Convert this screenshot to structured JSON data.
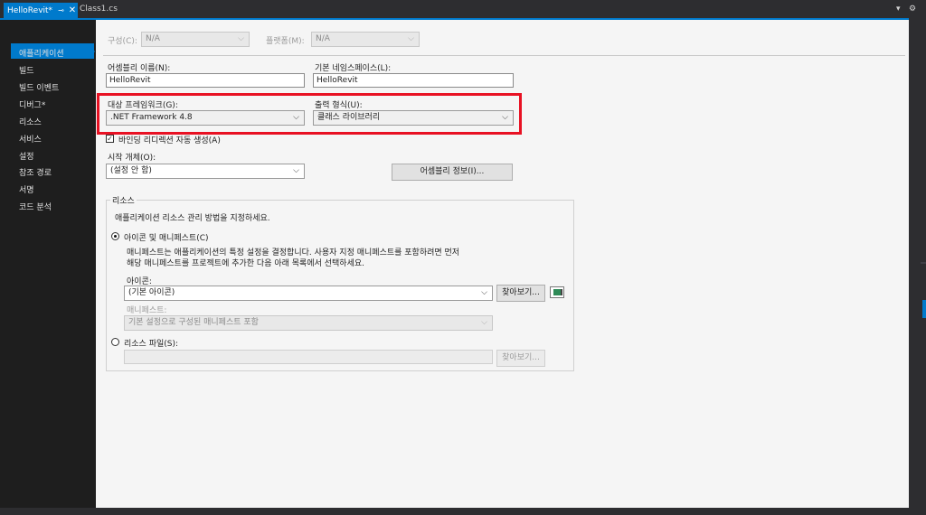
{
  "tabs": {
    "active_label": "HelloRevit*",
    "pin_glyph": "⊸",
    "close_glyph": "✕",
    "second_label": "Class1.cs",
    "dropdown_glyph": "▾",
    "settings_glyph": "⚙"
  },
  "nav": {
    "items": [
      "애플리케이션",
      "빌드",
      "빌드 이벤트",
      "디버그*",
      "리소스",
      "서비스",
      "설정",
      "참조 경로",
      "서명",
      "코드 분석"
    ]
  },
  "config": {
    "config_label": "구성(C):",
    "config_value": "N/A",
    "platform_label": "플랫폼(M):",
    "platform_value": "N/A"
  },
  "assembly": {
    "name_label": "어셈블리 이름(N):",
    "name_value": "HelloRevit",
    "namespace_label": "기본 네임스페이스(L):",
    "namespace_value": "HelloRevit",
    "framework_label": "대상 프레임워크(G):",
    "framework_value": ".NET Framework 4.8",
    "output_label": "출력 형식(U):",
    "output_value": "클래스 라이브러리",
    "binding_label": "바인딩 리디렉션 자동 생성(A)",
    "binding_check": "✓",
    "startup_label": "시작 개체(O):",
    "startup_value": "(설정 안 함)",
    "assembly_info_button": "어셈블리 정보(I)..."
  },
  "resources": {
    "group_title": "리소스",
    "description": "애플리케이션 리소스 관리 방법을 지정하세요.",
    "icon_manifest_radio": "아이콘 및 매니페스트(C)",
    "manifest_desc_1": "매니페스트는 애플리케이션의 특정 설정을 결정합니다. 사용자 지정 매니페스트를 포함하려면 먼저",
    "manifest_desc_2": "해당 매니페스트를 프로젝트에 추가한 다음 아래 목록에서 선택하세요.",
    "icon_label": "아이콘:",
    "icon_value": "(기본 아이콘)",
    "browse_button": "찾아보기...",
    "manifest_label": "매니페스트:",
    "manifest_value": "기본 설정으로 구성된 매니페스트 포함",
    "resource_file_radio": "리소스 파일(S):",
    "resource_file_value": "",
    "browse_button_2": "찾아보기..."
  },
  "chevron": "⌵",
  "colors": {
    "accent": "#007acc",
    "highlight": "#e81123",
    "nav_bg": "#1e1e1e",
    "content_bg": "#f5f5f5"
  }
}
